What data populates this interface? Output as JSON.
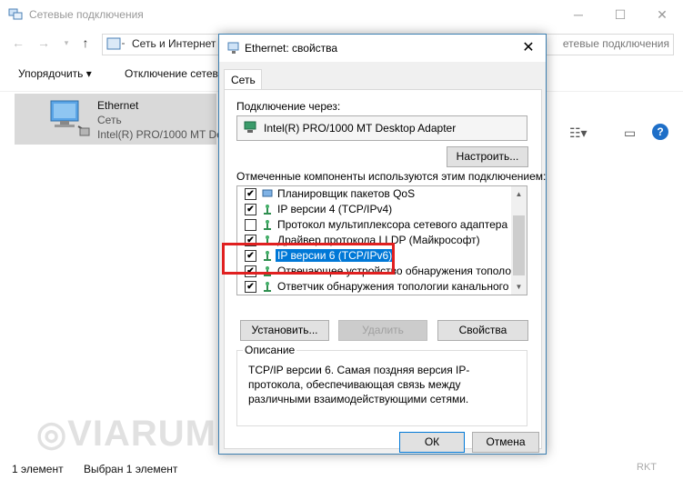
{
  "explorer": {
    "title": "Сетевые подключения",
    "address": "Сеть и Интернет",
    "search_text": "етевые подключения",
    "commands": [
      "Упорядочить ▾",
      "Отключение сетев"
    ],
    "item": {
      "name": "Ethernet",
      "line2": "Сеть",
      "line3": "Intel(R) PRO/1000 MT De"
    },
    "status_count": "1 элемент",
    "status_selected": "Выбран 1 элемент",
    "watermark": "VIARUM",
    "corner_mark": "RKT"
  },
  "dialog": {
    "title": "Ethernet: свойства",
    "tab": "Сеть",
    "connect_label": "Подключение через:",
    "adapter": "Intel(R) PRO/1000 MT Desktop Adapter",
    "configure": "Настроить...",
    "components_label": "Отмеченные компоненты используются этим подключением:",
    "components": [
      {
        "text": "Планировщик пакетов QoS",
        "checked": "✔",
        "icon": "qos-icon"
      },
      {
        "text": "IP версии 4 (TCP/IPv4)",
        "checked": "✔",
        "icon": "protocol-icon"
      },
      {
        "text": "Протокол мультиплексора сетевого адаптера (Ма",
        "checked": "",
        "icon": "protocol-icon"
      },
      {
        "text": "Драйвер протокола LLDP (Майкрософт)",
        "checked": "✔",
        "icon": "protocol-icon"
      },
      {
        "text": "IP версии 6 (TCP/IPv6)",
        "checked": "✔",
        "icon": "protocol-icon"
      },
      {
        "text": "Отвечающее устройство обнаружения топологии к",
        "checked": "✔",
        "icon": "protocol-icon"
      },
      {
        "text": "Ответчик обнаружения топологии канального уров",
        "checked": "✔",
        "icon": "protocol-icon"
      }
    ],
    "install": "Установить...",
    "remove": "Удалить",
    "properties": "Свойства",
    "description_label": "Описание",
    "description": "TCP/IP версии 6. Самая поздняя версия IP-протокола, обеспечивающая связь между различными взаимодействующими сетями.",
    "ok": "ОК",
    "cancel": "Отмена"
  },
  "colors": {
    "selection": "#0078d7",
    "highlight_frame": "#e02020",
    "dialog_border": "#3c7fb1"
  }
}
